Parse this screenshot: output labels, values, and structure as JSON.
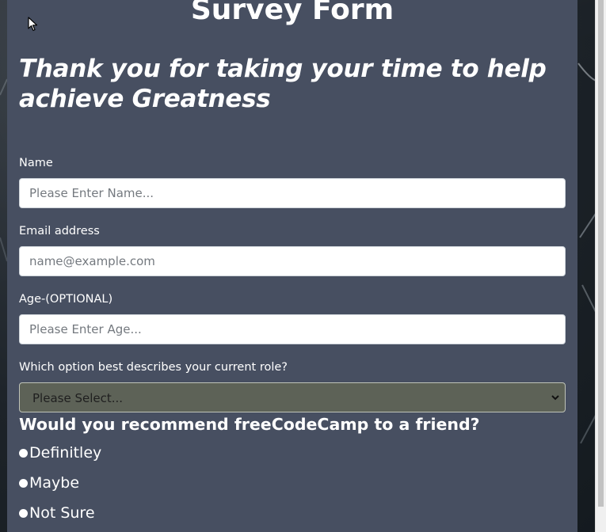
{
  "form": {
    "title": "Survey Form",
    "subtitle": "Thank you for taking your time to help achieve Greatness",
    "fields": [
      {
        "label": "Name",
        "placeholder": "Please Enter Name...",
        "value": ""
      },
      {
        "label": "Email address",
        "placeholder": "name@example.com",
        "value": ""
      },
      {
        "label": "Age-(OPTIONAL)",
        "placeholder": "Please Enter Age...",
        "value": ""
      }
    ],
    "role": {
      "label": "Which option best describes your current role?",
      "selected": "Please Select..."
    },
    "recommend": {
      "question": "Would you recommend freeCodeCamp to a friend?",
      "options": [
        "Definitley",
        "Maybe",
        "Not Sure"
      ]
    }
  },
  "colors": {
    "card": "#474f61",
    "select_bg": "#5d6257",
    "text": "#ffffff"
  },
  "icons": {
    "cursor": "mouse-pointer-icon",
    "select": "chevron-down-icon"
  }
}
